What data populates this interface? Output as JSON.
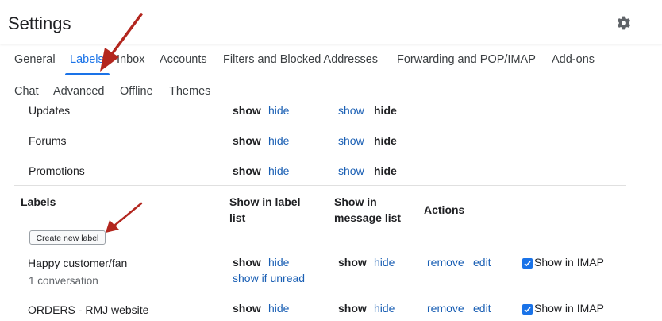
{
  "header": {
    "title": "Settings",
    "settings_icon": "gear-icon"
  },
  "tabs": [
    {
      "label": "General",
      "active": false
    },
    {
      "label": "Labels",
      "active": true
    },
    {
      "label": "Inbox",
      "active": false
    },
    {
      "label": "Accounts",
      "active": false
    },
    {
      "label": "Filters and Blocked Addresses",
      "active": false
    },
    {
      "label": "Forwarding and POP/IMAP",
      "active": false
    },
    {
      "label": "Add-ons",
      "active": false
    },
    {
      "label": "Chat",
      "active": false
    },
    {
      "label": "Advanced",
      "active": false
    },
    {
      "label": "Offline",
      "active": false
    },
    {
      "label": "Themes",
      "active": false
    }
  ],
  "categories": [
    {
      "name": "Updates",
      "show": "show",
      "hide": "hide",
      "msg_show": "show",
      "msg_hide": "hide"
    },
    {
      "name": "Forums",
      "show": "show",
      "hide": "hide",
      "msg_show": "show",
      "msg_hide": "hide"
    },
    {
      "name": "Promotions",
      "show": "show",
      "hide": "hide",
      "msg_show": "show",
      "msg_hide": "hide"
    }
  ],
  "labels_section": {
    "heading": "Labels",
    "col_label_list": "Show in label list",
    "col_message_list": "Show in message list",
    "col_actions": "Actions",
    "create_button": "Create new label"
  },
  "labels": [
    {
      "name": "Happy customer/fan",
      "count": "1 conversation",
      "show": "show",
      "hide": "hide",
      "show_if_unread": "show if unread",
      "msg_show": "show",
      "msg_hide": "hide",
      "remove": "remove",
      "edit": "edit",
      "imap": "Show in IMAP",
      "imap_checked": true
    },
    {
      "name": "ORDERS - RMJ website",
      "show": "show",
      "hide": "hide",
      "msg_show": "show",
      "msg_hide": "hide",
      "remove": "remove",
      "edit": "edit",
      "imap": "Show in IMAP",
      "imap_checked": true
    }
  ],
  "colors": {
    "accent": "#1a73e8",
    "link": "#1a5fb4",
    "annotation_arrow": "#b3261e"
  }
}
